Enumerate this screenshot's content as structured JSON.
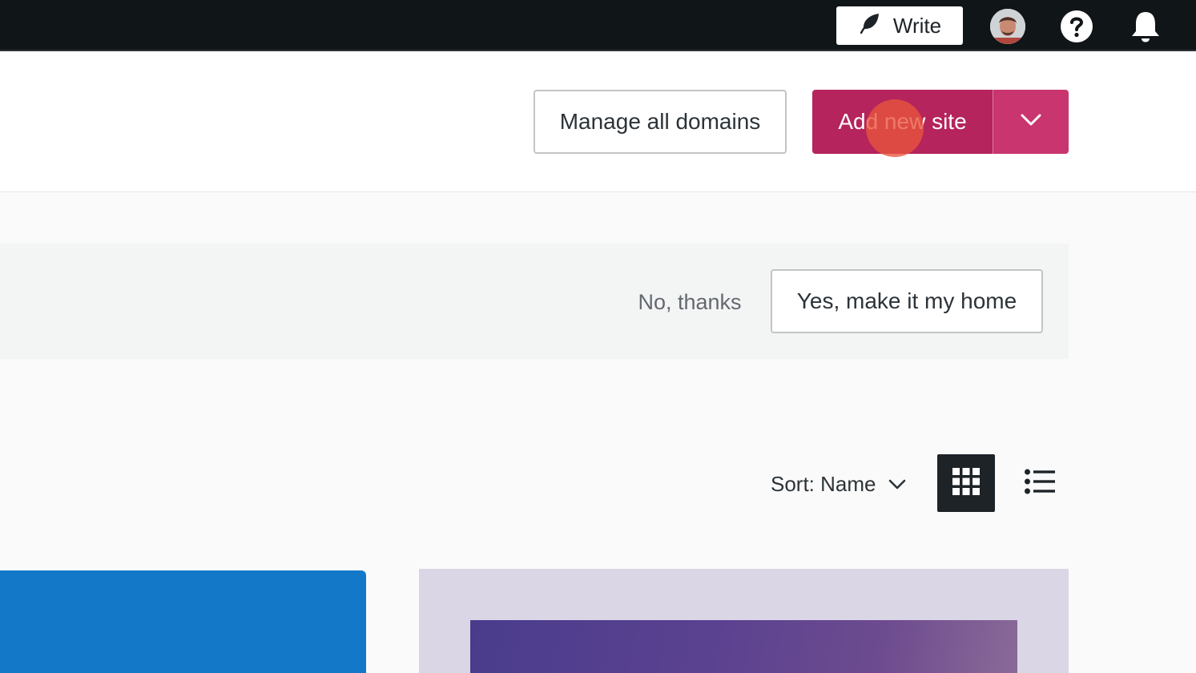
{
  "topbar": {
    "write_label": "Write",
    "icons": [
      "leaf-icon",
      "avatar",
      "help-icon",
      "bell-icon"
    ]
  },
  "header": {
    "manage_domains_label": "Manage all domains",
    "add_site_label": "Add new site"
  },
  "banner": {
    "dismiss_label": "No, thanks",
    "accept_label": "Yes, make it my home"
  },
  "toolbar": {
    "sort_label": "Sort: Name"
  },
  "colors": {
    "topbar": "#101517",
    "primary": "#b5245c",
    "primary_dropdown": "#c9356e",
    "card_blue": "#1378c8",
    "card_lavender": "#dad6e6"
  }
}
